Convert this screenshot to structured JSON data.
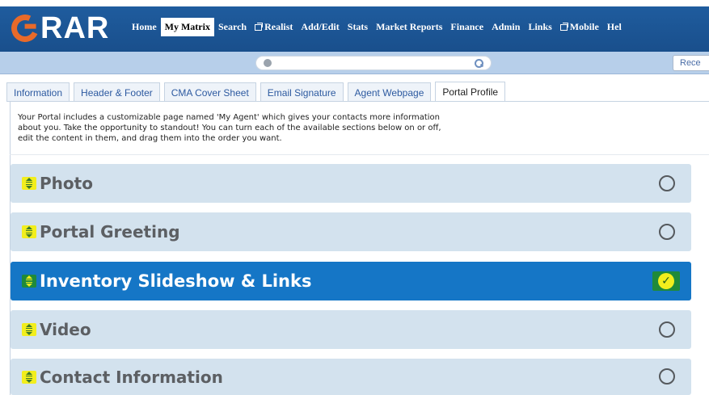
{
  "header": {
    "logo_text": "RAR",
    "nav": [
      {
        "label": "Home",
        "active": false,
        "ext": false
      },
      {
        "label": "My Matrix",
        "active": true,
        "ext": false
      },
      {
        "label": "Search",
        "active": false,
        "ext": false
      },
      {
        "label": "Realist",
        "active": false,
        "ext": true
      },
      {
        "label": "Add/Edit",
        "active": false,
        "ext": false
      },
      {
        "label": "Stats",
        "active": false,
        "ext": false
      },
      {
        "label": "Market Reports",
        "active": false,
        "ext": false
      },
      {
        "label": "Finance",
        "active": false,
        "ext": false
      },
      {
        "label": "Admin",
        "active": false,
        "ext": false
      },
      {
        "label": "Links",
        "active": false,
        "ext": false
      },
      {
        "label": "Mobile",
        "active": false,
        "ext": true
      },
      {
        "label": "Hel",
        "active": false,
        "ext": false
      }
    ]
  },
  "searchbar": {
    "recent_label": "Rece"
  },
  "tabs": [
    {
      "label": "Information",
      "active": false
    },
    {
      "label": "Header & Footer",
      "active": false
    },
    {
      "label": "CMA Cover Sheet",
      "active": false
    },
    {
      "label": "Email Signature",
      "active": false
    },
    {
      "label": "Agent Webpage",
      "active": false
    },
    {
      "label": "Portal Profile",
      "active": true
    }
  ],
  "intro": {
    "line1": "Your Portal includes a customizable page named 'My Agent' which gives your contacts more information",
    "line2": "about you. Take the opportunity to standout! You can turn each of the available sections below on or off,",
    "line3": "edit the content in them, and drag them into the order you want."
  },
  "sections": [
    {
      "title": "Photo",
      "enabled": false
    },
    {
      "title": "Portal Greeting",
      "enabled": false
    },
    {
      "title": "Inventory Slideshow & Links",
      "enabled": true
    },
    {
      "title": "Video",
      "enabled": false
    },
    {
      "title": "Contact Information",
      "enabled": false
    }
  ],
  "colors": {
    "header_blue": "#1f5c9e",
    "active_section": "#1576c6",
    "inactive_section": "#d3e2ee",
    "highlight_yellow": "#f2ee1d",
    "logo_orange": "#e86a2a"
  }
}
